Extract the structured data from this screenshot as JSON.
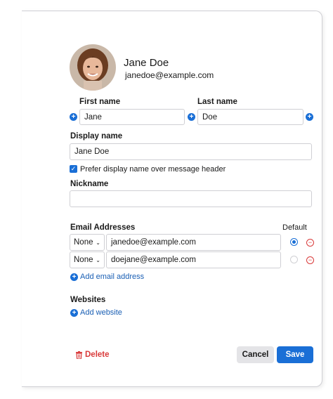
{
  "contact": {
    "name": "Jane Doe",
    "email": "janedoe@example.com"
  },
  "form": {
    "first_name_label": "First name",
    "first_name_value": "Jane",
    "last_name_label": "Last name",
    "last_name_value": "Doe",
    "display_name_label": "Display name",
    "display_name_value": "Jane Doe",
    "prefer_label": "Prefer display name over message header",
    "nickname_label": "Nickname",
    "nickname_value": ""
  },
  "emails": {
    "section_label": "Email Addresses",
    "default_label": "Default",
    "rows": [
      {
        "type": "None",
        "address": "janedoe@example.com",
        "default": true
      },
      {
        "type": "None",
        "address": "doejane@example.com",
        "default": false
      }
    ],
    "add_label": "Add email address"
  },
  "websites": {
    "section_label": "Websites",
    "add_label": "Add website"
  },
  "actions": {
    "delete_label": "Delete",
    "cancel_label": "Cancel",
    "save_label": "Save"
  },
  "colors": {
    "accent": "#1a6fd6",
    "danger": "#d93a3a",
    "link": "#1a5fb4"
  }
}
